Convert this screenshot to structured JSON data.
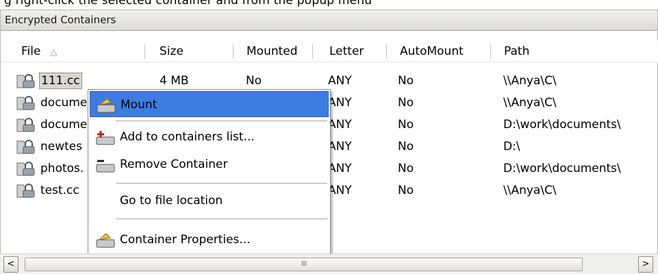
{
  "caption_cut": "g right-click the selected container and from the popup menu",
  "panel": {
    "title": "Encrypted Containers"
  },
  "columns": [
    {
      "key": "file",
      "label": "File",
      "sort": "△"
    },
    {
      "key": "size",
      "label": "Size"
    },
    {
      "key": "mounted",
      "label": "Mounted"
    },
    {
      "key": "letter",
      "label": "Letter"
    },
    {
      "key": "automount",
      "label": "AutoMount"
    },
    {
      "key": "path",
      "label": "Path"
    }
  ],
  "rows": [
    {
      "file": "111.cc",
      "size": "4 MB",
      "mounted": "No",
      "letter": "ANY",
      "automount": "No",
      "path": "\\\\Anya\\C\\"
    },
    {
      "file": "docume",
      "size": "",
      "mounted": "",
      "letter": "ANY",
      "automount": "No",
      "path": "\\\\Anya\\C\\"
    },
    {
      "file": "docume",
      "size": "",
      "mounted": "",
      "letter": "ANY",
      "automount": "No",
      "path": "D:\\work\\documents\\"
    },
    {
      "file": "newtes",
      "size": "",
      "mounted": "",
      "letter": "ANY",
      "automount": "No",
      "path": "D:\\"
    },
    {
      "file": "photos.",
      "size": "",
      "mounted": "",
      "letter": "ANY",
      "automount": "No",
      "path": "D:\\work\\documents\\"
    },
    {
      "file": "test.cc",
      "size": "",
      "mounted": "",
      "letter": "ANY",
      "automount": "No",
      "path": "\\\\Anya\\C\\"
    }
  ],
  "context_menu": {
    "items": [
      {
        "label": "Mount",
        "icon": "mount-icon",
        "highlighted": true
      },
      {
        "label": "Add to containers list...",
        "icon": "add-container-icon"
      },
      {
        "label": "Remove Container",
        "icon": "remove-container-icon"
      },
      {
        "label": "Go to file location",
        "icon": ""
      },
      {
        "label": "Container Properties...",
        "icon": "properties-icon"
      }
    ]
  },
  "scrollbar": {
    "left_arrow": "<",
    "right_arrow": ">",
    "grip": "IIII"
  },
  "colors": {
    "menu_highlight": "#3d7ce0",
    "header_bg": "#dcdad3"
  }
}
